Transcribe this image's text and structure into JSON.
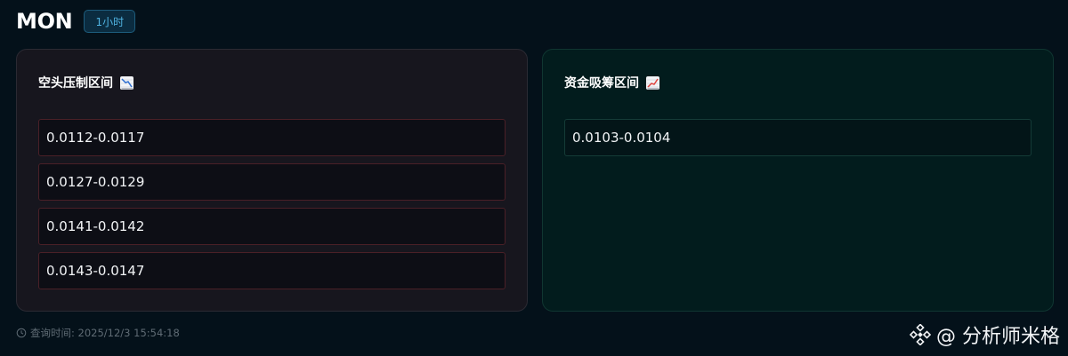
{
  "header": {
    "symbol": "MON",
    "timeframe": "1小时"
  },
  "resistance": {
    "title": "空头压制区间",
    "icon": "chart-decreasing-icon",
    "accent": "#4a2027",
    "zones": [
      "0.0112-0.0117",
      "0.0127-0.0129",
      "0.0141-0.0142",
      "0.0143-0.0147"
    ]
  },
  "accumulation": {
    "title": "资金吸筹区间",
    "icon": "chart-increasing-icon",
    "accent": "#143b37",
    "zones": [
      "0.0103-0.0104"
    ]
  },
  "footer": {
    "query_time": "查询时间: 2025/12/3 15:54:18"
  },
  "watermark": {
    "text": "@ 分析师米格",
    "icon": "binance-logo-icon"
  }
}
